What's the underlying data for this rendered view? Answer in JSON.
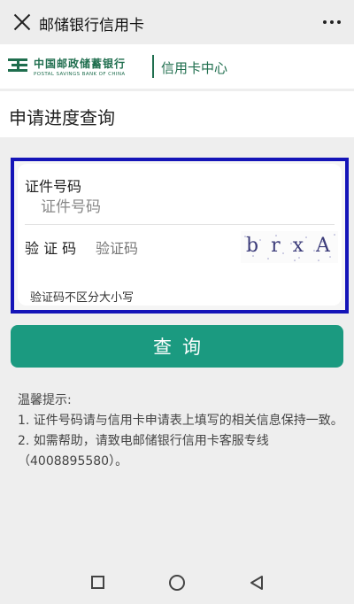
{
  "window": {
    "title": "邮储银行信用卡"
  },
  "brand": {
    "name_cn": "中国邮政储蓄银行",
    "name_en": "POSTAL SAVINGS BANK OF CHINA",
    "center": "信用卡中心"
  },
  "page": {
    "title": "申请进度查询"
  },
  "form": {
    "id_label": "证件号码",
    "id_placeholder": "证件号码",
    "id_value": "",
    "captcha_label": "验 证 码",
    "captcha_placeholder": "验证码",
    "captcha_value": "",
    "captcha_image_text": "brxA",
    "captcha_note": "验证码不区分大小写"
  },
  "actions": {
    "query_label": "查询"
  },
  "tips": {
    "heading": "温馨提示:",
    "items": [
      "1. 证件号码请与信用卡申请表上填写的相关信息保持一致。",
      "2. 如需帮助，请致电邮储银行信用卡客服专线（4008895580）。"
    ]
  },
  "colors": {
    "accent": "#1b9a80",
    "brand_green": "#1f6e4e",
    "highlight_border": "#1414b8"
  },
  "icons": {
    "close": "close-icon",
    "more": "more-icon",
    "logo": "postal-logo-icon",
    "nav_recent": "square-icon",
    "nav_home": "circle-icon",
    "nav_back": "triangle-back-icon"
  }
}
